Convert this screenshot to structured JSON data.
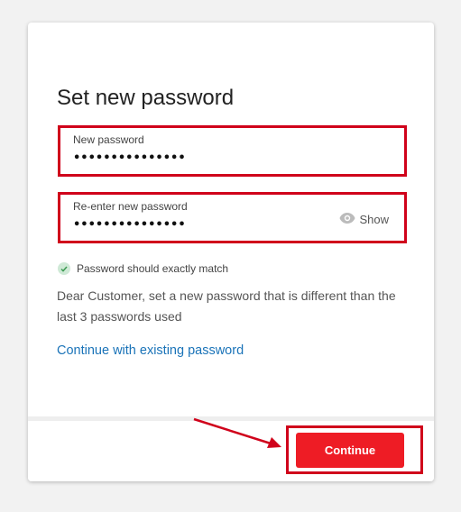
{
  "form": {
    "title": "Set new password",
    "new_password": {
      "label": "New password",
      "value": "•••••••••••••••"
    },
    "reenter_password": {
      "label": "Re-enter new password",
      "value": "•••••••••••••••",
      "show_label": "Show"
    },
    "hint": {
      "text": "Password should exactly match",
      "icon": "check-circle-icon"
    },
    "description": "Dear Customer, set a new password that is different than the last 3 passwords used",
    "existing_link": "Continue with existing password",
    "continue_label": "Continue"
  },
  "colors": {
    "accent_red": "#ee1c25",
    "annotation_red": "#d0021b",
    "link_blue": "#1a73b8",
    "success_green": "#4caf50"
  }
}
